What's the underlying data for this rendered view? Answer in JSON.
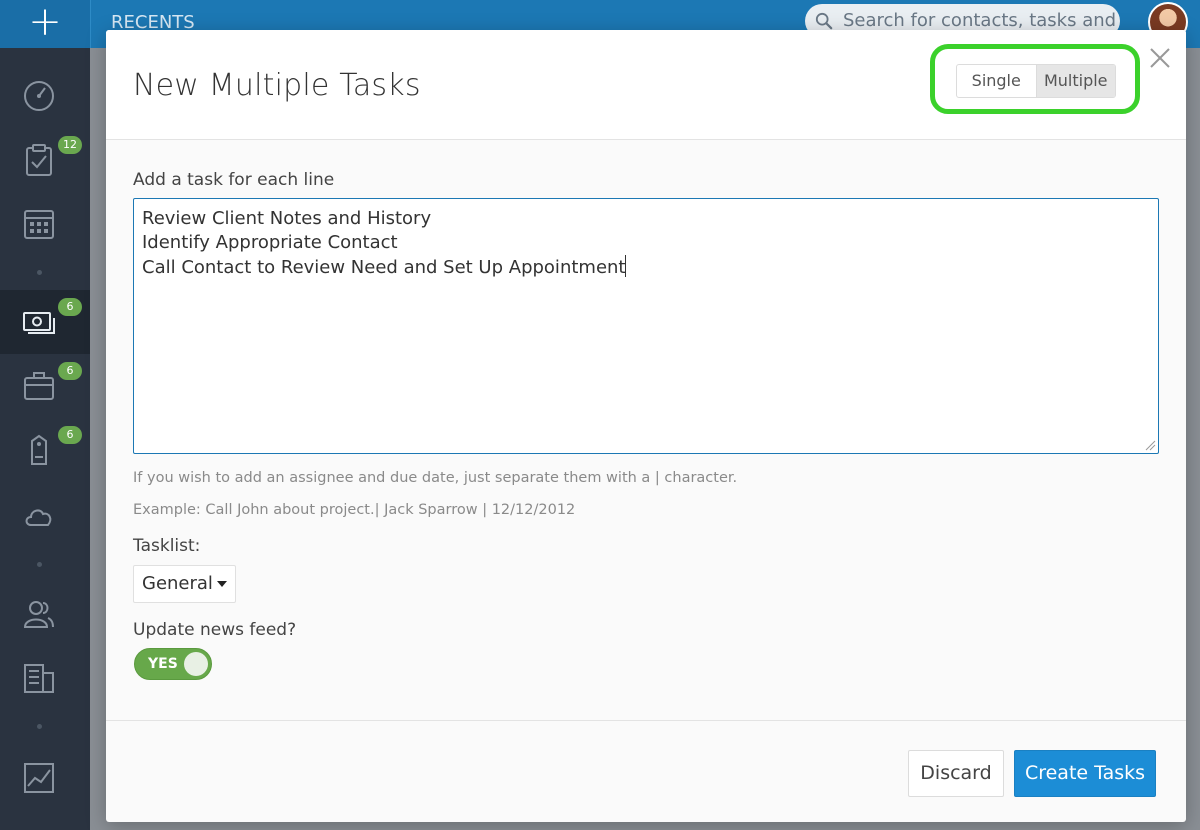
{
  "topbar": {
    "add_label": "+",
    "recents_label": "RECENTS",
    "search_placeholder": "Search for contacts, tasks and t"
  },
  "sidebar": {
    "items": [
      {
        "icon": "dashboard-icon",
        "badge": ""
      },
      {
        "icon": "tasks-icon",
        "badge": "12"
      },
      {
        "icon": "calendar-icon",
        "badge": ""
      },
      {
        "icon": "money-icon",
        "badge": "6"
      },
      {
        "icon": "briefcase-icon",
        "badge": "6"
      },
      {
        "icon": "tag-icon",
        "badge": "6"
      },
      {
        "icon": "cloud-icon",
        "badge": ""
      },
      {
        "icon": "contacts-icon",
        "badge": ""
      },
      {
        "icon": "building-icon",
        "badge": ""
      },
      {
        "icon": "chart-icon",
        "badge": ""
      }
    ]
  },
  "modal": {
    "title": "New Multiple Tasks",
    "mode_single": "Single",
    "mode_multiple": "Multiple",
    "tasks_label": "Add a task for each line",
    "tasks": [
      "Review Client Notes and History",
      "Identify Appropriate Contact",
      "Call Contact to Review Need and Set Up Appointment"
    ],
    "help_line1": "If you wish to add an assignee and due date, just separate them with a | character.",
    "help_line2": "Example: Call John about project.| Jack Sparrow | 12/12/2012",
    "tasklist_label": "Tasklist:",
    "tasklist_value": "General",
    "newsfeed_label": "Update news feed?",
    "newsfeed_toggle": "YES",
    "discard_label": "Discard",
    "create_label": "Create Tasks"
  },
  "colors": {
    "topbar": "#1c78b4",
    "sidebar": "#2a3340",
    "badge": "#6aa84f",
    "primary_button": "#1c8dd6",
    "highlight": "#3bd12b",
    "toggle_on": "#67a84a"
  }
}
